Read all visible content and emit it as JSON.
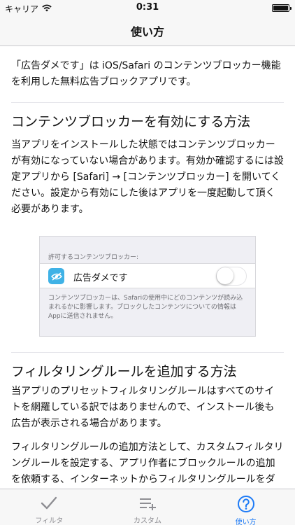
{
  "status_bar": {
    "carrier": "キャリア",
    "time": "0:31",
    "wifi_icon": "wifi-icon",
    "battery_icon": "battery-icon"
  },
  "nav": {
    "title": "使い方"
  },
  "content": {
    "intro": "「広告ダメです」は iOS/Safari のコンテンツブロッカー機能を利用した無料広告ブロックアプリです。",
    "section1": {
      "title": "コンテンツブロッカーを有効にする方法",
      "body": "当アプリをインストールした状態ではコンテンツブロッカーが有効になっていない場合があります。有効か確認するには設定アプリから [Safari] → [コンテンツブロッカー] を開いてください。設定から有効にした後はアプリを一度起動して頂く必要があります。"
    },
    "settings_mock": {
      "header": "許可するコンテンツブロッカー:",
      "row_label": "広告ダメです",
      "toggle_on": false,
      "footer": "コンテンツブロッカーは、Safariの使用中にどのコンテンツが読み込まれるかに影響します。ブロックしたコンテンツについての情報はAppに送信されません。",
      "app_icon": "eye-slash-icon",
      "app_icon_color": "#3fb2e6"
    },
    "section2": {
      "title": "フィルタリングルールを追加する方法",
      "body1": "当アプリのプリセットフィルタリングルールはすべてのサイトを網羅している訳ではありませんので、インストール後も広告が表示される場合があります。",
      "body2": "フィルタリングルールの追加方法として、カスタムフィルタリングルールを設定する、アプリ作者にブロックルールの追加を依頼する、インターネットからフィルタリングルールをダウンロードする方法を用意しています。"
    }
  },
  "tab_bar": {
    "tabs": [
      {
        "label": "フィルタ",
        "icon": "checkmark-icon",
        "active": false
      },
      {
        "label": "カスタム",
        "icon": "list-add-icon",
        "active": false
      },
      {
        "label": "使い方",
        "icon": "question-circle-icon",
        "active": true
      }
    ],
    "active_color": "#1e7bf6",
    "inactive_color": "#8e8e93"
  }
}
